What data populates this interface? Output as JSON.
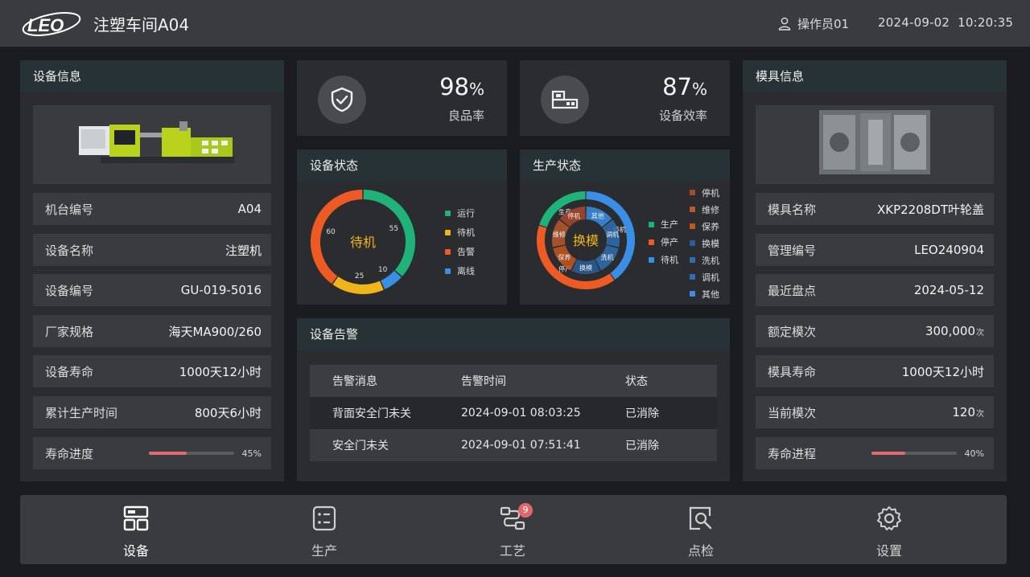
{
  "header": {
    "logo_text": "LEO",
    "title": "注塑车间A04",
    "user": "操作员01",
    "date": "2024-09-02",
    "time": "10:20:35"
  },
  "equipment_info": {
    "title": "设备信息",
    "rows": [
      {
        "label": "机台编号",
        "value": "A04"
      },
      {
        "label": "设备名称",
        "value": "注塑机"
      },
      {
        "label": "设备编号",
        "value": "GU-019-5016"
      },
      {
        "label": "厂家规格",
        "value": "海天MA900/260"
      },
      {
        "label": "设备寿命",
        "value": "1000天12小时"
      },
      {
        "label": "累计生产时间",
        "value": "800天6小时"
      }
    ],
    "life_progress": {
      "label": "寿命进度",
      "percent": 45,
      "percent_text": "45%"
    }
  },
  "kpis": [
    {
      "value": "98",
      "unit": "%",
      "label": "良品率",
      "icon": "shield-check-icon"
    },
    {
      "value": "87",
      "unit": "%",
      "label": "设备效率",
      "icon": "machine-icon"
    }
  ],
  "device_status": {
    "title": "设备状态",
    "center_label": "待机",
    "segments": [
      {
        "name": "运行",
        "value": 55,
        "color": "#1fb37a"
      },
      {
        "name": "待机",
        "value": 25,
        "color": "#f1b51c"
      },
      {
        "name": "告警",
        "value": 60,
        "color": "#ee5a24"
      },
      {
        "name": "离线",
        "value": 10,
        "color": "#3a8ee6"
      }
    ]
  },
  "production_status": {
    "title": "生产状态",
    "center_label": "换模",
    "outer": [
      {
        "name": "生产",
        "value": 20,
        "color": "#1fb37a"
      },
      {
        "name": "停产",
        "value": 40,
        "color": "#ee5a24"
      },
      {
        "name": "待机",
        "value": 40,
        "color": "#3a8ee6"
      }
    ],
    "inner": [
      {
        "name": "其他",
        "color": "#3a8ee6"
      },
      {
        "name": "调机",
        "color": "#2f6fb0"
      },
      {
        "name": "洗机",
        "color": "#2f6fb0"
      },
      {
        "name": "换模",
        "color": "#2a5e9a"
      },
      {
        "name": "保养",
        "color": "#c4561e"
      },
      {
        "name": "维修",
        "color": "#b85a2c"
      },
      {
        "name": "停机",
        "color": "#a8492a"
      }
    ],
    "legend_outer": [
      {
        "name": "生产",
        "color": "#1fb37a"
      },
      {
        "name": "停产",
        "color": "#ee5a24"
      },
      {
        "name": "待机",
        "color": "#3a8ee6"
      }
    ],
    "legend_inner": [
      {
        "name": "停机",
        "color": "#a8492a"
      },
      {
        "name": "维修",
        "color": "#b85a2c"
      },
      {
        "name": "保养",
        "color": "#c4561e"
      },
      {
        "name": "换模",
        "color": "#2a5e9a"
      },
      {
        "name": "洗机",
        "color": "#2f6fb0"
      },
      {
        "name": "调机",
        "color": "#2f6fb0"
      },
      {
        "name": "其他",
        "color": "#3a8ee6"
      }
    ]
  },
  "alarms": {
    "title": "设备告警",
    "columns": [
      "告警消息",
      "告警时间",
      "状态"
    ],
    "rows": [
      {
        "msg": "背面安全门未关",
        "time": "2024-09-01 08:03:25",
        "status": "已消除"
      },
      {
        "msg": "安全门未关",
        "time": "2024-09-01 07:51:41",
        "status": "已消除"
      }
    ]
  },
  "mold_info": {
    "title": "模具信息",
    "rows": [
      {
        "label": "模具名称",
        "value": "XKP2208DT叶轮盖",
        "unit": ""
      },
      {
        "label": "管理编号",
        "value": "LEO240904",
        "unit": ""
      },
      {
        "label": "最近盘点",
        "value": "2024-05-12",
        "unit": ""
      },
      {
        "label": "额定模次",
        "value": "300,000",
        "unit": "次"
      },
      {
        "label": "模具寿命",
        "value": "1000天12小时",
        "unit": ""
      },
      {
        "label": "当前模次",
        "value": "120",
        "unit": "次"
      }
    ],
    "life_progress": {
      "label": "寿命进程",
      "percent": 40,
      "percent_text": "40%"
    }
  },
  "nav": [
    {
      "label": "设备",
      "icon": "equipment-icon",
      "active": true
    },
    {
      "label": "生产",
      "icon": "production-list-icon",
      "active": false
    },
    {
      "label": "工艺",
      "icon": "process-flow-icon",
      "active": false,
      "badge": "9"
    },
    {
      "label": "点检",
      "icon": "inspection-icon",
      "active": false
    },
    {
      "label": "设置",
      "icon": "gear-icon",
      "active": false
    }
  ],
  "colors": {
    "background": "#1b1c1f",
    "panel": "#2b2c30",
    "panel_header": "#273236",
    "row": "#3a3b3f",
    "progress": "#e26b70",
    "accent_text": "#f1b51c"
  }
}
